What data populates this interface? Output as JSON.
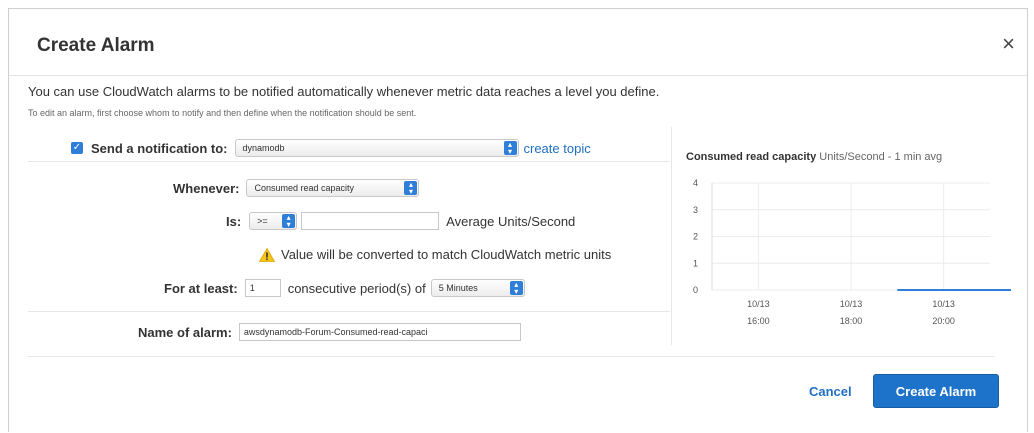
{
  "dialog": {
    "title": "Create Alarm",
    "close_glyph": "×"
  },
  "intro": {
    "text": "You can use CloudWatch alarms to be notified automatically whenever metric data reaches a level you define.",
    "subtext": "To edit an alarm, first choose whom to notify and then define when the notification should be sent."
  },
  "form": {
    "notify": {
      "checked": true,
      "label": "Send a notification to:",
      "value": "dynamodb",
      "create_topic_link": "create topic"
    },
    "whenever": {
      "label": "Whenever:",
      "value": "Consumed read capacity"
    },
    "is": {
      "label": "Is:",
      "operator": ">=",
      "threshold": "",
      "unit_text": "Average Units/Second"
    },
    "warning": {
      "text": "Value will be converted to match CloudWatch metric units"
    },
    "for_at_least": {
      "label": "For at least:",
      "periods": "1",
      "mid_text": "consecutive period(s) of",
      "period": "5 Minutes"
    },
    "name": {
      "label": "Name of alarm:",
      "value": "awsdynamodb-Forum-Consumed-read-capaci"
    }
  },
  "chart_data": {
    "type": "line",
    "title": "Consumed read capacity",
    "subtitle": "Units/Second - 1 min avg",
    "xlabel": "",
    "ylabel": "",
    "ylim": [
      0,
      4
    ],
    "yticks": [
      "0",
      "1",
      "2",
      "3",
      "4"
    ],
    "xticks": [
      {
        "date": "10/13",
        "time": "16:00"
      },
      {
        "date": "10/13",
        "time": "18:00"
      },
      {
        "date": "10/13",
        "time": "20:00"
      }
    ],
    "series": [
      {
        "x": [
          "19:00",
          "21:30"
        ],
        "values": [
          0,
          0
        ],
        "color": "#2f7fd8"
      }
    ],
    "grid": true
  },
  "footer": {
    "cancel_label": "Cancel",
    "create_label": "Create Alarm"
  },
  "colors": {
    "accent": "#1d73c9",
    "link": "#1f6fc5"
  },
  "icons": {
    "warning": "warning-triangle-icon",
    "close": "close-icon",
    "select": "select-arrows-icon"
  }
}
